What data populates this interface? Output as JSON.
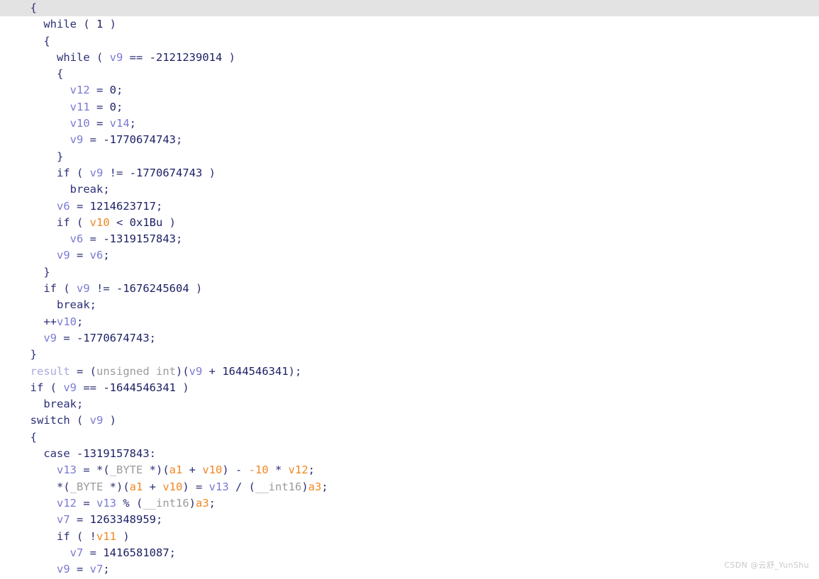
{
  "view": {
    "kind": "decompiler-pseudocode",
    "background_color": "#ffffff",
    "highlight_row_color": "#e3e3e3",
    "highlighted_line_index": 0
  },
  "palette": {
    "punctuation": "#2b2f77",
    "keyword": "#2b2f77",
    "number": "#1b1f63",
    "variable": "#7a7ad4",
    "highlight_symbol": "#f28722",
    "type": "#9b9b9b",
    "result": "#a9a9e0"
  },
  "watermark": {
    "text": "CSDN @云舒_YunShu"
  },
  "code": {
    "lines": [
      {
        "highlighted": true,
        "tokens": [
          {
            "t": "  ",
            "c": "punct"
          },
          {
            "t": "{",
            "c": "punct"
          }
        ]
      },
      {
        "highlighted": false,
        "tokens": [
          {
            "t": "    ",
            "c": "punct"
          },
          {
            "t": "while",
            "c": "kw"
          },
          {
            "t": " ( ",
            "c": "punct"
          },
          {
            "t": "1",
            "c": "num"
          },
          {
            "t": " )",
            "c": "punct"
          }
        ]
      },
      {
        "highlighted": false,
        "tokens": [
          {
            "t": "    ",
            "c": "punct"
          },
          {
            "t": "{",
            "c": "punct"
          }
        ]
      },
      {
        "highlighted": false,
        "tokens": [
          {
            "t": "      ",
            "c": "punct"
          },
          {
            "t": "while",
            "c": "kw"
          },
          {
            "t": " ( ",
            "c": "punct"
          },
          {
            "t": "v9",
            "c": "var"
          },
          {
            "t": " == ",
            "c": "punct"
          },
          {
            "t": "-2121239014",
            "c": "num"
          },
          {
            "t": " )",
            "c": "punct"
          }
        ]
      },
      {
        "highlighted": false,
        "tokens": [
          {
            "t": "      ",
            "c": "punct"
          },
          {
            "t": "{",
            "c": "punct"
          }
        ]
      },
      {
        "highlighted": false,
        "tokens": [
          {
            "t": "        ",
            "c": "punct"
          },
          {
            "t": "v12",
            "c": "var"
          },
          {
            "t": " = ",
            "c": "punct"
          },
          {
            "t": "0",
            "c": "num"
          },
          {
            "t": ";",
            "c": "punct"
          }
        ]
      },
      {
        "highlighted": false,
        "tokens": [
          {
            "t": "        ",
            "c": "punct"
          },
          {
            "t": "v11",
            "c": "var"
          },
          {
            "t": " = ",
            "c": "punct"
          },
          {
            "t": "0",
            "c": "num"
          },
          {
            "t": ";",
            "c": "punct"
          }
        ]
      },
      {
        "highlighted": false,
        "tokens": [
          {
            "t": "        ",
            "c": "punct"
          },
          {
            "t": "v10",
            "c": "var"
          },
          {
            "t": " = ",
            "c": "punct"
          },
          {
            "t": "v14",
            "c": "var"
          },
          {
            "t": ";",
            "c": "punct"
          }
        ]
      },
      {
        "highlighted": false,
        "tokens": [
          {
            "t": "        ",
            "c": "punct"
          },
          {
            "t": "v9",
            "c": "var"
          },
          {
            "t": " = ",
            "c": "punct"
          },
          {
            "t": "-1770674743",
            "c": "num"
          },
          {
            "t": ";",
            "c": "punct"
          }
        ]
      },
      {
        "highlighted": false,
        "tokens": [
          {
            "t": "      ",
            "c": "punct"
          },
          {
            "t": "}",
            "c": "punct"
          }
        ]
      },
      {
        "highlighted": false,
        "tokens": [
          {
            "t": "      ",
            "c": "punct"
          },
          {
            "t": "if",
            "c": "kw"
          },
          {
            "t": " ( ",
            "c": "punct"
          },
          {
            "t": "v9",
            "c": "var"
          },
          {
            "t": " != ",
            "c": "punct"
          },
          {
            "t": "-1770674743",
            "c": "num"
          },
          {
            "t": " )",
            "c": "punct"
          }
        ]
      },
      {
        "highlighted": false,
        "tokens": [
          {
            "t": "        ",
            "c": "punct"
          },
          {
            "t": "break",
            "c": "kw"
          },
          {
            "t": ";",
            "c": "punct"
          }
        ]
      },
      {
        "highlighted": false,
        "tokens": [
          {
            "t": "      ",
            "c": "punct"
          },
          {
            "t": "v6",
            "c": "var"
          },
          {
            "t": " = ",
            "c": "punct"
          },
          {
            "t": "1214623717",
            "c": "num"
          },
          {
            "t": ";",
            "c": "punct"
          }
        ]
      },
      {
        "highlighted": false,
        "tokens": [
          {
            "t": "      ",
            "c": "punct"
          },
          {
            "t": "if",
            "c": "kw"
          },
          {
            "t": " ( ",
            "c": "punct"
          },
          {
            "t": "v10",
            "c": "hl"
          },
          {
            "t": " < ",
            "c": "punct"
          },
          {
            "t": "0x1Bu",
            "c": "num"
          },
          {
            "t": " )",
            "c": "punct"
          }
        ]
      },
      {
        "highlighted": false,
        "tokens": [
          {
            "t": "        ",
            "c": "punct"
          },
          {
            "t": "v6",
            "c": "var"
          },
          {
            "t": " = ",
            "c": "punct"
          },
          {
            "t": "-1319157843",
            "c": "num"
          },
          {
            "t": ";",
            "c": "punct"
          }
        ]
      },
      {
        "highlighted": false,
        "tokens": [
          {
            "t": "      ",
            "c": "punct"
          },
          {
            "t": "v9",
            "c": "var"
          },
          {
            "t": " = ",
            "c": "punct"
          },
          {
            "t": "v6",
            "c": "var"
          },
          {
            "t": ";",
            "c": "punct"
          }
        ]
      },
      {
        "highlighted": false,
        "tokens": [
          {
            "t": "    ",
            "c": "punct"
          },
          {
            "t": "}",
            "c": "punct"
          }
        ]
      },
      {
        "highlighted": false,
        "tokens": [
          {
            "t": "    ",
            "c": "punct"
          },
          {
            "t": "if",
            "c": "kw"
          },
          {
            "t": " ( ",
            "c": "punct"
          },
          {
            "t": "v9",
            "c": "var"
          },
          {
            "t": " != ",
            "c": "punct"
          },
          {
            "t": "-1676245604",
            "c": "num"
          },
          {
            "t": " )",
            "c": "punct"
          }
        ]
      },
      {
        "highlighted": false,
        "tokens": [
          {
            "t": "      ",
            "c": "punct"
          },
          {
            "t": "break",
            "c": "kw"
          },
          {
            "t": ";",
            "c": "punct"
          }
        ]
      },
      {
        "highlighted": false,
        "tokens": [
          {
            "t": "    ",
            "c": "punct"
          },
          {
            "t": "++",
            "c": "punct"
          },
          {
            "t": "v10",
            "c": "var"
          },
          {
            "t": ";",
            "c": "punct"
          }
        ]
      },
      {
        "highlighted": false,
        "tokens": [
          {
            "t": "    ",
            "c": "punct"
          },
          {
            "t": "v9",
            "c": "var"
          },
          {
            "t": " = ",
            "c": "punct"
          },
          {
            "t": "-1770674743",
            "c": "num"
          },
          {
            "t": ";",
            "c": "punct"
          }
        ]
      },
      {
        "highlighted": false,
        "tokens": [
          {
            "t": "  ",
            "c": "punct"
          },
          {
            "t": "}",
            "c": "punct"
          }
        ]
      },
      {
        "highlighted": false,
        "tokens": [
          {
            "t": "  ",
            "c": "punct"
          },
          {
            "t": "result",
            "c": "result"
          },
          {
            "t": " = (",
            "c": "punct"
          },
          {
            "t": "unsigned int",
            "c": "type"
          },
          {
            "t": ")(",
            "c": "punct"
          },
          {
            "t": "v9",
            "c": "var"
          },
          {
            "t": " + ",
            "c": "punct"
          },
          {
            "t": "1644546341",
            "c": "num"
          },
          {
            "t": ");",
            "c": "punct"
          }
        ]
      },
      {
        "highlighted": false,
        "tokens": [
          {
            "t": "  ",
            "c": "punct"
          },
          {
            "t": "if",
            "c": "kw"
          },
          {
            "t": " ( ",
            "c": "punct"
          },
          {
            "t": "v9",
            "c": "var"
          },
          {
            "t": " == ",
            "c": "punct"
          },
          {
            "t": "-1644546341",
            "c": "num"
          },
          {
            "t": " )",
            "c": "punct"
          }
        ]
      },
      {
        "highlighted": false,
        "tokens": [
          {
            "t": "    ",
            "c": "punct"
          },
          {
            "t": "break",
            "c": "kw"
          },
          {
            "t": ";",
            "c": "punct"
          }
        ]
      },
      {
        "highlighted": false,
        "tokens": [
          {
            "t": "  ",
            "c": "punct"
          },
          {
            "t": "switch",
            "c": "kw"
          },
          {
            "t": " ( ",
            "c": "punct"
          },
          {
            "t": "v9",
            "c": "var"
          },
          {
            "t": " )",
            "c": "punct"
          }
        ]
      },
      {
        "highlighted": false,
        "tokens": [
          {
            "t": "  ",
            "c": "punct"
          },
          {
            "t": "{",
            "c": "punct"
          }
        ]
      },
      {
        "highlighted": false,
        "tokens": [
          {
            "t": "    ",
            "c": "punct"
          },
          {
            "t": "case",
            "c": "kw"
          },
          {
            "t": " ",
            "c": "punct"
          },
          {
            "t": "-1319157843",
            "c": "num"
          },
          {
            "t": ":",
            "c": "punct"
          }
        ]
      },
      {
        "highlighted": false,
        "tokens": [
          {
            "t": "      ",
            "c": "punct"
          },
          {
            "t": "v13",
            "c": "var"
          },
          {
            "t": " = *(",
            "c": "punct"
          },
          {
            "t": "_BYTE",
            "c": "type"
          },
          {
            "t": " *)(",
            "c": "punct"
          },
          {
            "t": "a1",
            "c": "hl"
          },
          {
            "t": " + ",
            "c": "punct"
          },
          {
            "t": "v10",
            "c": "hl"
          },
          {
            "t": ") - ",
            "c": "punct"
          },
          {
            "t": "-10",
            "c": "hl"
          },
          {
            "t": " * ",
            "c": "punct"
          },
          {
            "t": "v12",
            "c": "hl"
          },
          {
            "t": ";",
            "c": "punct"
          }
        ]
      },
      {
        "highlighted": false,
        "tokens": [
          {
            "t": "      ",
            "c": "punct"
          },
          {
            "t": "*(",
            "c": "punct"
          },
          {
            "t": "_BYTE",
            "c": "type"
          },
          {
            "t": " *)(",
            "c": "punct"
          },
          {
            "t": "a1",
            "c": "hl"
          },
          {
            "t": " + ",
            "c": "punct"
          },
          {
            "t": "v10",
            "c": "hl"
          },
          {
            "t": ") = ",
            "c": "punct"
          },
          {
            "t": "v13",
            "c": "var"
          },
          {
            "t": " / (",
            "c": "punct"
          },
          {
            "t": "__int16",
            "c": "type"
          },
          {
            "t": ")",
            "c": "punct"
          },
          {
            "t": "a3",
            "c": "hl"
          },
          {
            "t": ";",
            "c": "punct"
          }
        ]
      },
      {
        "highlighted": false,
        "tokens": [
          {
            "t": "      ",
            "c": "punct"
          },
          {
            "t": "v12",
            "c": "var"
          },
          {
            "t": " = ",
            "c": "punct"
          },
          {
            "t": "v13",
            "c": "var"
          },
          {
            "t": " % (",
            "c": "punct"
          },
          {
            "t": "__int16",
            "c": "type"
          },
          {
            "t": ")",
            "c": "punct"
          },
          {
            "t": "a3",
            "c": "hl"
          },
          {
            "t": ";",
            "c": "punct"
          }
        ]
      },
      {
        "highlighted": false,
        "tokens": [
          {
            "t": "      ",
            "c": "punct"
          },
          {
            "t": "v7",
            "c": "var"
          },
          {
            "t": " = ",
            "c": "punct"
          },
          {
            "t": "1263348959",
            "c": "num"
          },
          {
            "t": ";",
            "c": "punct"
          }
        ]
      },
      {
        "highlighted": false,
        "tokens": [
          {
            "t": "      ",
            "c": "punct"
          },
          {
            "t": "if",
            "c": "kw"
          },
          {
            "t": " ( !",
            "c": "punct"
          },
          {
            "t": "v11",
            "c": "hl"
          },
          {
            "t": " )",
            "c": "punct"
          }
        ]
      },
      {
        "highlighted": false,
        "tokens": [
          {
            "t": "        ",
            "c": "punct"
          },
          {
            "t": "v7",
            "c": "var"
          },
          {
            "t": " = ",
            "c": "punct"
          },
          {
            "t": "1416581087",
            "c": "num"
          },
          {
            "t": ";",
            "c": "punct"
          }
        ]
      },
      {
        "highlighted": false,
        "tokens": [
          {
            "t": "      ",
            "c": "punct"
          },
          {
            "t": "v9",
            "c": "var"
          },
          {
            "t": " = ",
            "c": "punct"
          },
          {
            "t": "v7",
            "c": "var"
          },
          {
            "t": ";",
            "c": "punct"
          }
        ]
      }
    ]
  }
}
